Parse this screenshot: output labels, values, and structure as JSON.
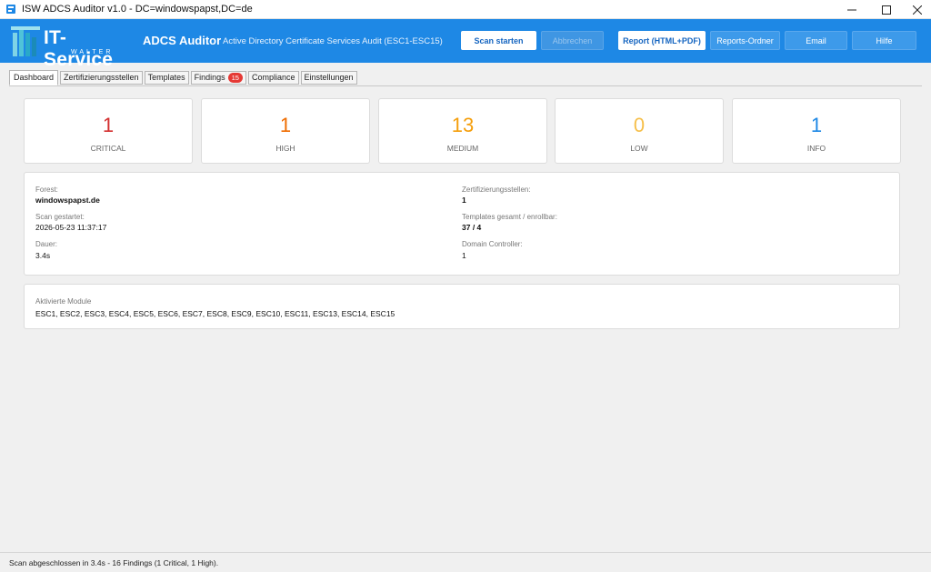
{
  "window": {
    "title": "ISW ADCS Auditor v1.0 - DC=windowspapst,DC=de"
  },
  "header": {
    "brand": "IT-Service",
    "brand_sub": "WALTER",
    "app_name": "ADCS Auditor",
    "app_desc": "Active Directory Certificate Services Audit (ESC1-ESC15)",
    "buttons": {
      "scan": "Scan starten",
      "cancel": "Abbrechen",
      "report": "Report (HTML+PDF)",
      "reports_folder": "Reports-Ordner",
      "email": "Email",
      "help": "Hilfe"
    },
    "colors": {
      "header_bg": "#1e88e5"
    }
  },
  "tabs": [
    {
      "label": "Dashboard"
    },
    {
      "label": "Zertifizierungsstellen"
    },
    {
      "label": "Templates"
    },
    {
      "label": "Findings",
      "badge": "15"
    },
    {
      "label": "Compliance"
    },
    {
      "label": "Einstellungen"
    }
  ],
  "stats": [
    {
      "value": "1",
      "label": "CRITICAL",
      "color": "#d32f2f"
    },
    {
      "value": "1",
      "label": "HIGH",
      "color": "#ef6c00"
    },
    {
      "value": "13",
      "label": "MEDIUM",
      "color": "#f59e0b"
    },
    {
      "value": "0",
      "label": "LOW",
      "color": "#f6bf4a"
    },
    {
      "value": "1",
      "label": "INFO",
      "color": "#1e88e5"
    }
  ],
  "info": {
    "forest_label": "Forest:",
    "forest_value": "windowspapst.de",
    "scan_started_label": "Scan gestartet:",
    "scan_started_value": "2026-05-23 11:37:17",
    "duration_label": "Dauer:",
    "duration_value": "3.4s",
    "cas_label": "Zertifizierungsstellen:",
    "cas_value": "1",
    "templates_label": "Templates gesamt / enrollbar:",
    "templates_value": "37 / 4",
    "dc_label": "Domain Controller:",
    "dc_value": "1"
  },
  "modules": {
    "label": "Aktivierte Module",
    "value": "ESC1, ESC2, ESC3, ESC4, ESC5, ESC6, ESC7, ESC8, ESC9, ESC10, ESC11, ESC13, ESC14, ESC15"
  },
  "status": {
    "text": "Scan abgeschlossen in 3.4s - 16 Findings (1 Critical, 1 High)."
  }
}
